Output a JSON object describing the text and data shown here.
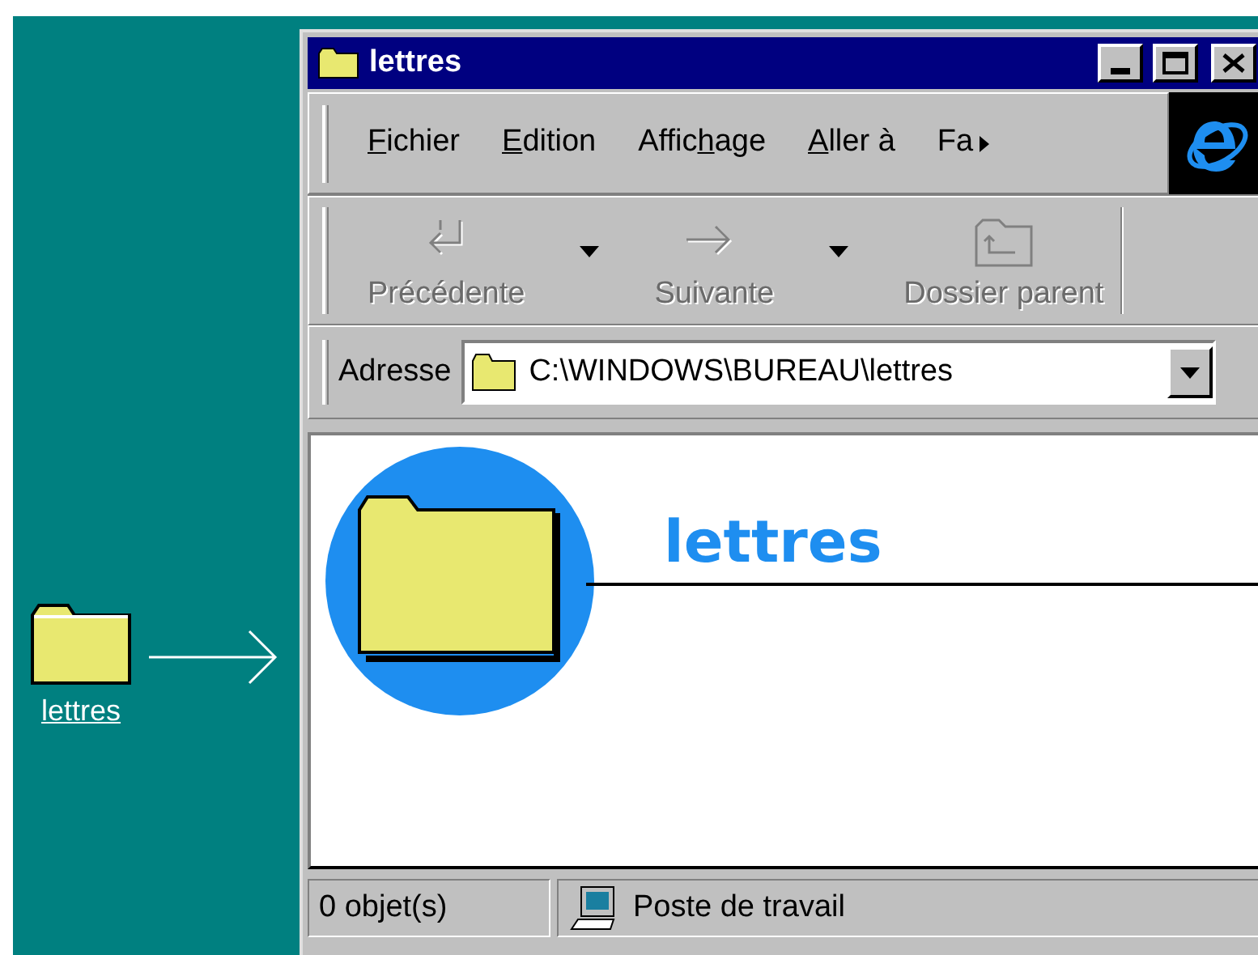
{
  "desktop_icon": {
    "label": "lettres"
  },
  "window": {
    "title": "lettres"
  },
  "menu": [
    {
      "key": "F",
      "post": "ichier"
    },
    {
      "key": "E",
      "post": "dition"
    },
    {
      "pre": "Affic",
      "key": "h",
      "post": "age"
    },
    {
      "key": "A",
      "post": "ller à"
    },
    {
      "pre": "Fa"
    }
  ],
  "toolbar": [
    {
      "kind": "back",
      "label": "Précédente",
      "disabled": true,
      "dropdown": true
    },
    {
      "kind": "forward",
      "label": "Suivante",
      "disabled": true,
      "dropdown": true
    },
    {
      "kind": "up",
      "label": "Dossier parent",
      "disabled": true,
      "dropdown": false
    }
  ],
  "address": {
    "label": "Adresse",
    "value": "C:\\WINDOWS\\BUREAU\\lettres"
  },
  "content": {
    "heading": "lettres"
  },
  "status_bar": {
    "count": "0 objet(s)",
    "zone": "Poste de travail"
  }
}
